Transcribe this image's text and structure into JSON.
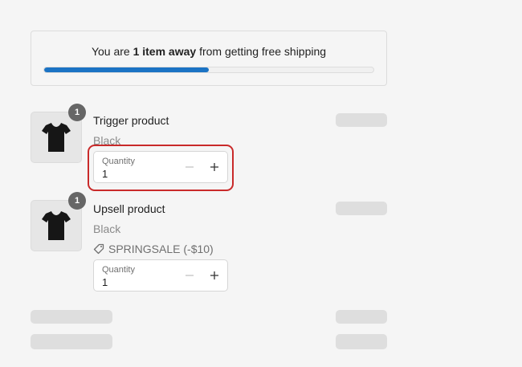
{
  "shipping": {
    "prefix": "You are ",
    "emphasis": "1 item away",
    "suffix": " from getting free shipping",
    "progress_fraction": 0.5,
    "progress_color": "#1b73c4"
  },
  "items": [
    {
      "title": "Trigger product",
      "variant": "Black",
      "badge": "1",
      "quantity_label": "Quantity",
      "quantity": "1",
      "icon": "tshirt-icon"
    },
    {
      "title": "Upsell product",
      "variant": "Black",
      "badge": "1",
      "discount": "SPRINGSALE (-$10)",
      "discount_icon": "tag-icon",
      "quantity_label": "Quantity",
      "quantity": "1",
      "icon": "tshirt-icon"
    }
  ],
  "colors": {
    "highlight": "#c92a2a",
    "background": "#f5f5f5",
    "skeleton": "#dedede"
  }
}
